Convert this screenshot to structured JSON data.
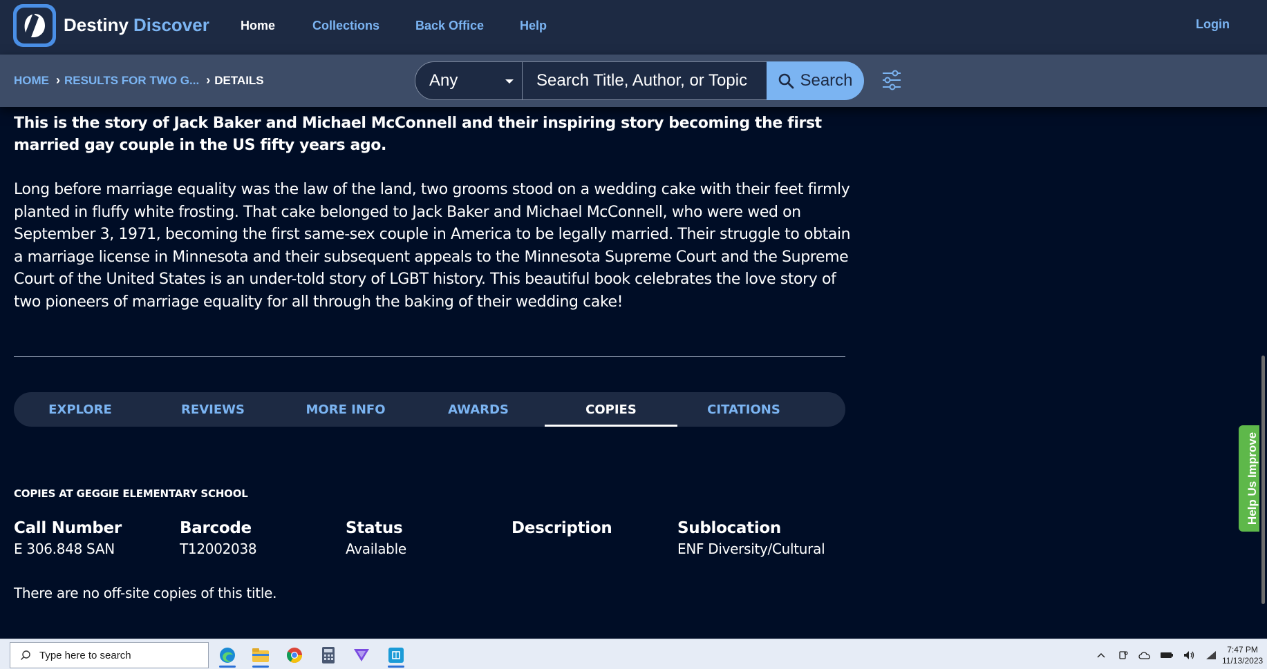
{
  "header": {
    "brand_primary": "Destiny",
    "brand_secondary": "Discover",
    "nav": {
      "home": "Home",
      "collections": "Collections",
      "back_office": "Back Office",
      "help": "Help",
      "login": "Login"
    }
  },
  "breadcrumb": {
    "home": "HOME",
    "results": "RESULTS FOR TWO G...",
    "current": "DETAILS"
  },
  "search": {
    "scope": "Any",
    "placeholder": "Search Title, Author, or Topic",
    "button_label": "Search"
  },
  "summary": {
    "lead": "This is the story of Jack Baker and Michael McConnell and their inspiring story becoming the first married gay couple in the US fifty years ago.",
    "body": "Long before marriage equality was the law of the land, two grooms stood on a wedding cake with their feet firmly planted in fluffy white frosting. That cake belonged to Jack Baker and Michael McConnell, who were wed on September 3, 1971, becoming the first same-sex couple in America to be legally married. Their struggle to obtain a marriage license in Minnesota and their subsequent appeals to the Minnesota Supreme Court and the Supreme Court of the United States is an under-told story of LGBT history. This beautiful book celebrates the love story of two pioneers of marriage equality for all through the baking of their wedding cake!"
  },
  "tabs": [
    "EXPLORE",
    "REVIEWS",
    "MORE INFO",
    "AWARDS",
    "COPIES",
    "CITATIONS"
  ],
  "active_tab": "COPIES",
  "copies": {
    "heading": "COPIES AT GEGGIE ELEMENTARY SCHOOL",
    "columns": [
      "Call Number",
      "Barcode",
      "Status",
      "Description",
      "Sublocation"
    ],
    "rows": [
      [
        "E 306.848 SAN",
        "T12002038",
        "Available",
        "",
        "ENF Diversity/Cultural"
      ]
    ],
    "offsite_note": "There are no off-site copies of this title."
  },
  "feedback_tab": "Help Us Improve",
  "taskbar": {
    "search_placeholder": "Type here to search",
    "time": "7:47 PM",
    "date": "11/13/2023",
    "apps": [
      "edge-icon",
      "file-explorer-icon",
      "chrome-icon",
      "calculator-icon",
      "vpn-icon",
      "store-icon"
    ]
  },
  "colors": {
    "background": "#000d26",
    "nav": "#1d2a43",
    "subbar": "#3d4c67",
    "accent": "#7bb4f2",
    "feedback": "#5eb84a"
  }
}
